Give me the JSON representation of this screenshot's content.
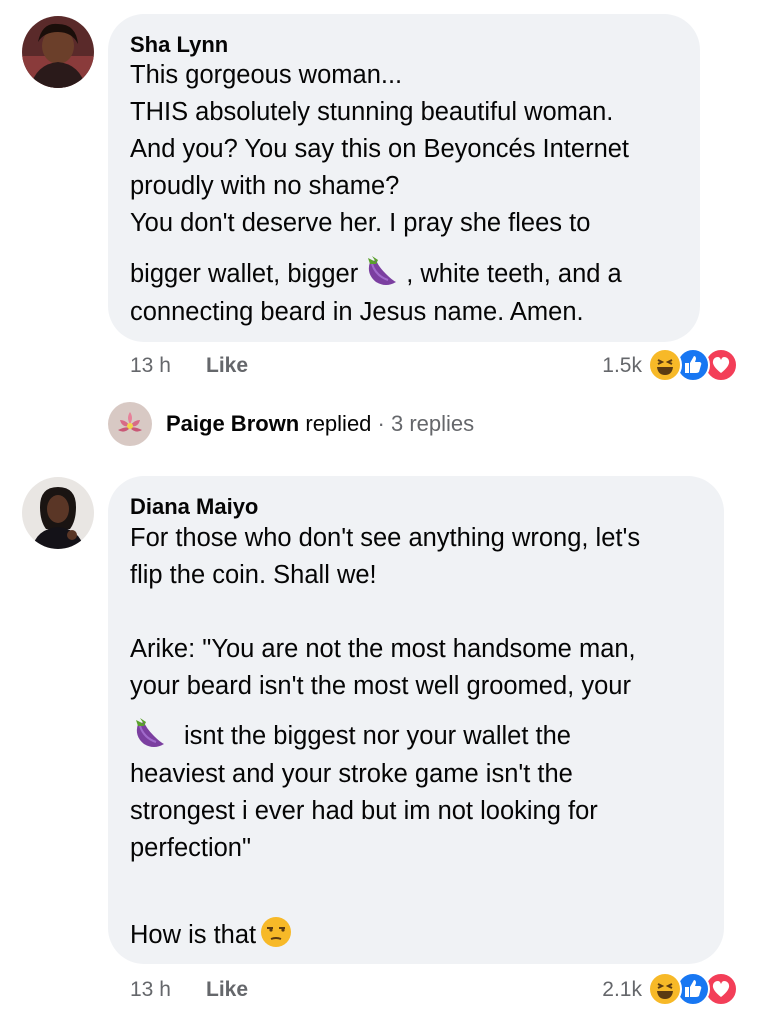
{
  "comments": [
    {
      "author": "Sha Lynn",
      "lines": [
        "This gorgeous woman...",
        "THIS absolutely stunning beautiful woman.",
        "And you? You say this on Beyoncés Internet",
        "proudly with no shame?",
        "You don't deserve her. I pray she flees to"
      ],
      "line6_part1": "bigger wallet, bigger",
      "line6_part2": ", white teeth, and a",
      "line7": "connecting beard in Jesus name. Amen.",
      "time": "13 h",
      "like_label": "Like",
      "reaction_count": "1.5k",
      "inline_icon": "eggplant-emoji"
    },
    {
      "author": "Diana Maiyo",
      "lines": [
        "For those who don't see anything wrong, let's",
        "flip the coin. Shall we!",
        "Arike:  \"You are not the most handsome man,",
        "your beard isn't the most well groomed, your"
      ],
      "line5_part": "isnt the biggest nor your wallet the",
      "lines_after": [
        "heaviest and your stroke game isn't the",
        "strongest i ever had but im not looking for",
        "perfection\""
      ],
      "last_line": "How is that",
      "time": "13 h",
      "like_label": "Like",
      "reaction_count": "2.1k",
      "inline_icon": "unamused-face-emoji"
    }
  ],
  "reply": {
    "name": "Paige Brown",
    "action": "replied",
    "separator": "·",
    "count": "3 replies"
  },
  "colors": {
    "bubble": "#f0f2f5",
    "meta": "#65676b",
    "like_blue": "#1877f2",
    "love_red": "#f33e58",
    "haha_yellow": "#f7b928"
  },
  "reaction_icons": [
    "haha-reaction-icon",
    "like-reaction-icon",
    "love-reaction-icon"
  ]
}
